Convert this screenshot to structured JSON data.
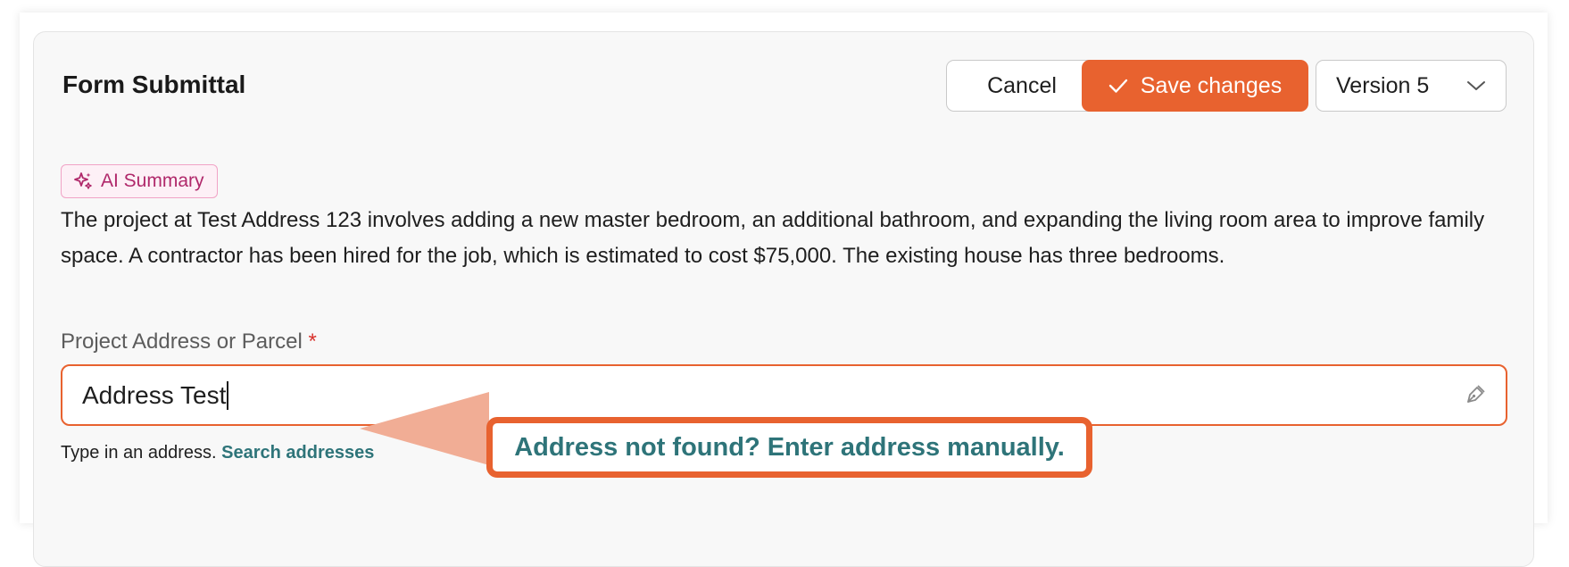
{
  "header": {
    "title": "Form Submittal",
    "cancel_label": "Cancel",
    "save_label": "Save changes",
    "version_label": "Version 5"
  },
  "ai_summary": {
    "badge_label": "AI Summary",
    "text": "The project at Test Address 123 involves adding a new master bedroom, an additional bathroom, and expanding the living room area to improve family space. A contractor has been hired for the job, which is estimated to cost $75,000. The existing house has three bedrooms."
  },
  "address_field": {
    "label": "Project Address or Parcel",
    "required_marker": "*",
    "value": "Address Test",
    "helper_text": "Type in an address.",
    "search_link": "Search addresses"
  },
  "callout": {
    "text": "Address not found? Enter address manually."
  },
  "colors": {
    "accent": "#e8622f",
    "link": "#2e7479",
    "ai_badge": "#b0286a",
    "required": "#d8312b"
  },
  "icons": [
    "check-icon",
    "chevron-down-icon",
    "sparkles-icon",
    "pen-icon"
  ]
}
